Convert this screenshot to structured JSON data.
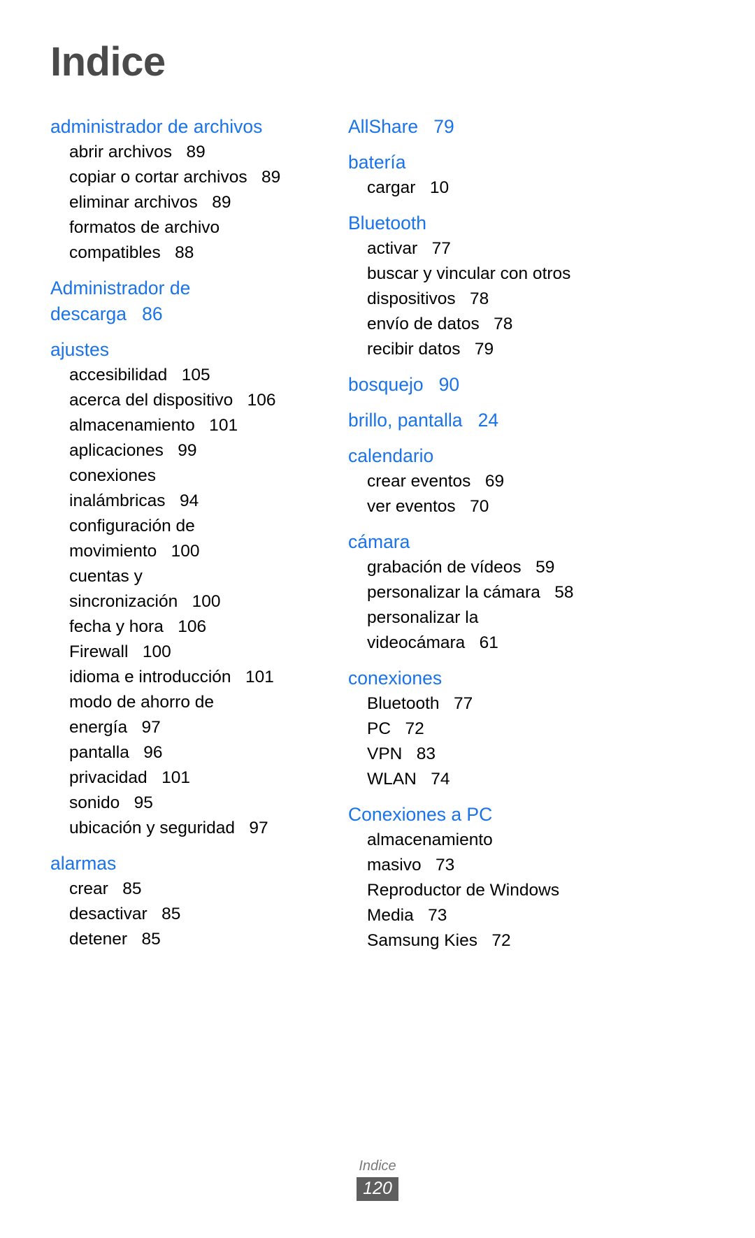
{
  "document": {
    "title": "Indice",
    "heading_color": "#1a73e8",
    "title_color": "#4a4a4a"
  },
  "footer": {
    "label": "Indice",
    "page_number": "120"
  },
  "columns": {
    "left": [
      {
        "heading": "administrador de archivos",
        "subentries": [
          "abrir archivos   89",
          "copiar o cortar archivos   89",
          "eliminar archivos   89",
          "formatos de archivo\ncompatibles   88"
        ]
      },
      {
        "heading": "Administrador de\ndescarga   86",
        "subentries": []
      },
      {
        "heading": "ajustes",
        "subentries": [
          "accesibilidad   105",
          "acerca del dispositivo   106",
          "almacenamiento   101",
          "aplicaciones   99",
          "conexiones\ninalámbricas   94",
          "configuración de\nmovimiento   100",
          "cuentas y\nsincronización   100",
          "fecha y hora   106",
          "Firewall   100",
          "idioma e introducción   101",
          "modo de ahorro de\nenergía   97",
          "pantalla   96",
          "privacidad   101",
          "sonido   95",
          "ubicación y seguridad   97"
        ]
      },
      {
        "heading": "alarmas",
        "subentries": [
          "crear   85",
          "desactivar   85",
          "detener   85"
        ]
      }
    ],
    "right": [
      {
        "heading": "AllShare   79",
        "subentries": []
      },
      {
        "heading": "batería",
        "subentries": [
          "cargar   10"
        ]
      },
      {
        "heading": "Bluetooth",
        "subentries": [
          "activar   77",
          "buscar y vincular con otros\ndispositivos   78",
          "envío de datos   78",
          "recibir datos   79"
        ]
      },
      {
        "heading": "bosquejo   90",
        "subentries": []
      },
      {
        "heading": "brillo, pantalla   24",
        "subentries": []
      },
      {
        "heading": "calendario",
        "subentries": [
          "crear eventos   69",
          "ver eventos   70"
        ]
      },
      {
        "heading": "cámara",
        "subentries": [
          "grabación de vídeos   59",
          "personalizar la cámara   58",
          "personalizar la\nvideocámara   61"
        ]
      },
      {
        "heading": "conexiones",
        "subentries": [
          "Bluetooth   77",
          "PC   72",
          "VPN   83",
          "WLAN   74"
        ]
      },
      {
        "heading": "Conexiones a PC",
        "subentries": [
          "almacenamiento\nmasivo   73",
          "Reproductor de Windows\nMedia   73",
          "Samsung Kies   72"
        ]
      }
    ]
  }
}
